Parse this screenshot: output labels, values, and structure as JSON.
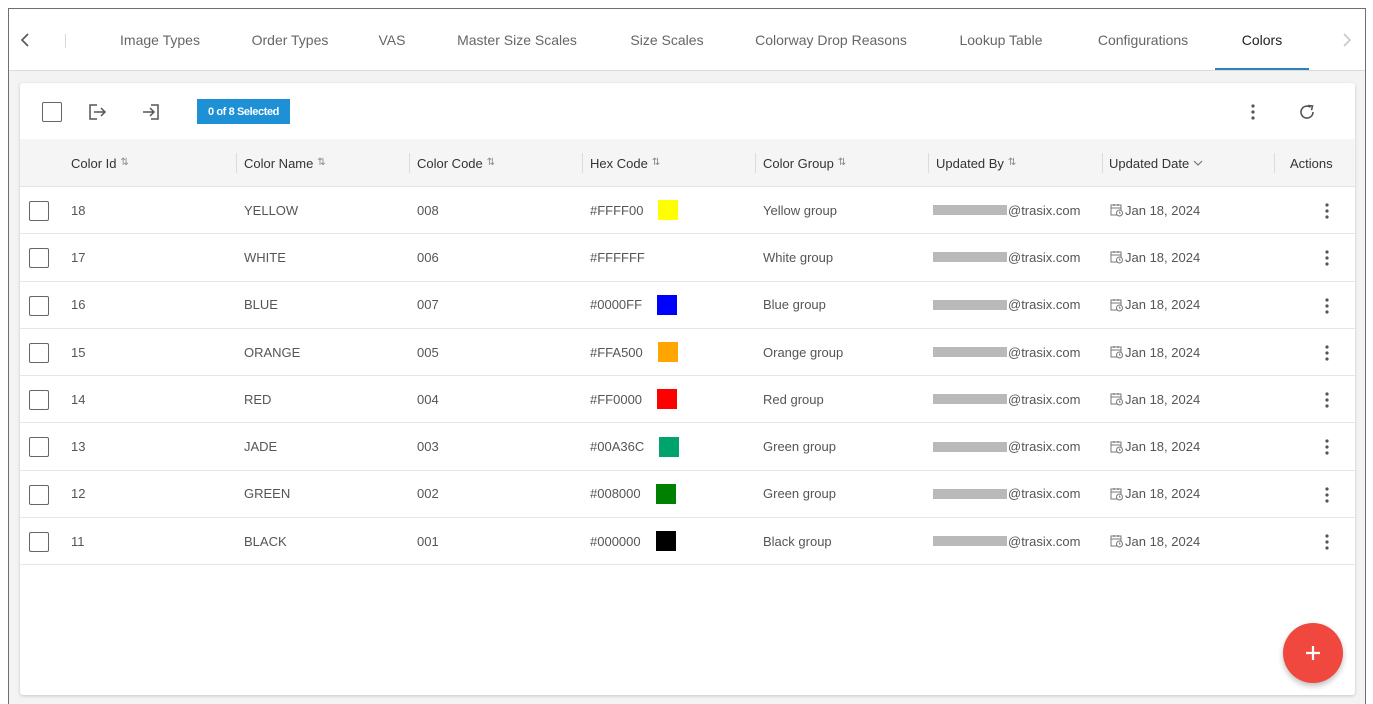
{
  "tabs": [
    {
      "label": "Image Types"
    },
    {
      "label": "Order Types"
    },
    {
      "label": "VAS"
    },
    {
      "label": "Master Size Scales"
    },
    {
      "label": "Size Scales"
    },
    {
      "label": "Colorway Drop Reasons"
    },
    {
      "label": "Lookup Table"
    },
    {
      "label": "Configurations"
    },
    {
      "label": "Colors"
    }
  ],
  "active_tab": "Colors",
  "toolbar": {
    "selection_badge": "0 of 8 Selected",
    "icons": {
      "export": "export-icon",
      "import": "import-icon",
      "more": "more-vertical-icon",
      "refresh": "refresh-icon"
    }
  },
  "table": {
    "columns": [
      {
        "label": "Color Id"
      },
      {
        "label": "Color Name"
      },
      {
        "label": "Color Code"
      },
      {
        "label": "Hex Code"
      },
      {
        "label": "Color Group"
      },
      {
        "label": "Updated By"
      },
      {
        "label": "Updated Date"
      },
      {
        "label": "Actions"
      }
    ],
    "rows": [
      {
        "id": "18",
        "name": "YELLOW",
        "code": "008",
        "hex": "#FFFF00",
        "swatch": "#FFFF00",
        "group": "Yellow group",
        "updated_by": "@trasix.com",
        "updated_date": "Jan 18, 2024"
      },
      {
        "id": "17",
        "name": "WHITE",
        "code": "006",
        "hex": "#FFFFFF",
        "swatch": "#FFFFFF",
        "group": "White group",
        "updated_by": "@trasix.com",
        "updated_date": "Jan 18, 2024"
      },
      {
        "id": "16",
        "name": "BLUE",
        "code": "007",
        "hex": "#0000FF",
        "swatch": "#0000FF",
        "group": "Blue group",
        "updated_by": "@trasix.com",
        "updated_date": "Jan 18, 2024"
      },
      {
        "id": "15",
        "name": "ORANGE",
        "code": "005",
        "hex": "#FFA500",
        "swatch": "#FFA500",
        "group": "Orange group",
        "updated_by": "@trasix.com",
        "updated_date": "Jan 18, 2024"
      },
      {
        "id": "14",
        "name": "RED",
        "code": "004",
        "hex": "#FF0000",
        "swatch": "#FF0000",
        "group": "Red group",
        "updated_by": "@trasix.com",
        "updated_date": "Jan 18, 2024"
      },
      {
        "id": "13",
        "name": "JADE",
        "code": "003",
        "hex": "#00A36C",
        "swatch": "#00A36C",
        "group": "Green group",
        "updated_by": "@trasix.com",
        "updated_date": "Jan 18, 2024"
      },
      {
        "id": "12",
        "name": "GREEN",
        "code": "002",
        "hex": "#008000",
        "swatch": "#008000",
        "group": "Green group",
        "updated_by": "@trasix.com",
        "updated_date": "Jan 18, 2024"
      },
      {
        "id": "11",
        "name": "BLACK",
        "code": "001",
        "hex": "#000000",
        "swatch": "#000000",
        "group": "Black group",
        "updated_by": "@trasix.com",
        "updated_date": "Jan 18, 2024"
      }
    ]
  },
  "fab": {
    "label": "+"
  },
  "colors": {
    "accent": "#1d90d6",
    "tab_underline": "#2f7fb8",
    "fab": "#f0483e"
  }
}
